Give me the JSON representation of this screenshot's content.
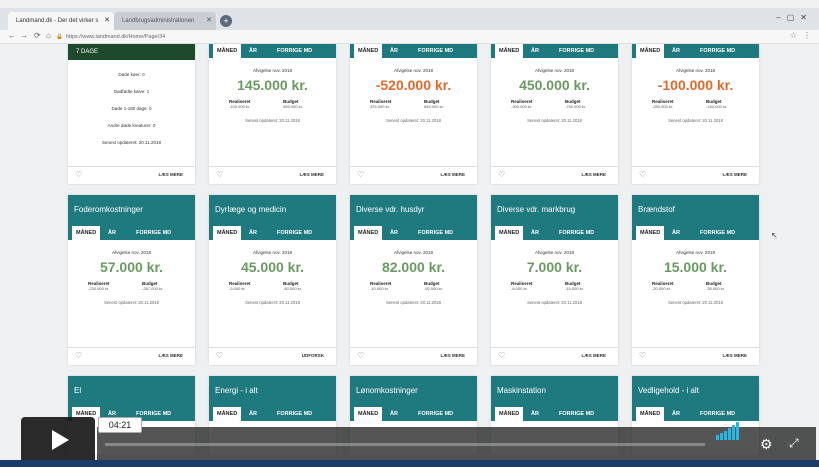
{
  "browser": {
    "tab_active": "Landmand.dk - Der det virker s",
    "tab_inactive": "Landbrugsadministrationen",
    "url": "https://www.landmand.dk/Home/Page/34",
    "new_tab": "+"
  },
  "first_card": {
    "header": "7 DAGE",
    "stats": [
      "Døde køer: 0",
      "Dødfødte kalve: 1",
      "Døde 1-180 dage: 0",
      "Andre døde kreaturer: 0"
    ],
    "updated": "Senest opdateret: 20.11.2018",
    "more": "LÆS MERE"
  },
  "tabs": {
    "t1": "MÅNED",
    "t2": "ÅR",
    "t3": "FORRIGE MD"
  },
  "row1": [
    {
      "amount": "145.000 kr.",
      "negative": false,
      "real": "-100.000 kr.",
      "budget": "355.000 kr."
    },
    {
      "amount": "-520.000 kr.",
      "negative": true,
      "real": "325.000 kr.",
      "budget": "845.000 kr."
    },
    {
      "amount": "450.000 kr.",
      "negative": false,
      "real": "-300.000 kr.",
      "budget": "-750.000 kr."
    },
    {
      "amount": "-100.000 kr.",
      "negative": true,
      "real": "-250.000 kr.",
      "budget": "-150.000 kr."
    }
  ],
  "row2": [
    {
      "title": "Foderomkostninger",
      "amount": "57.000 kr.",
      "real": "-230.000 kr.",
      "budget": "-287.000 kr.",
      "more": "LÆS MERE"
    },
    {
      "title": "Dyrlæge og medicin",
      "amount": "45.000 kr.",
      "real": "-5.000 kr.",
      "budget": "-50.000 kr.",
      "more": "UDFORSK"
    },
    {
      "title": "Diverse vdr. husdyr",
      "amount": "82.000 kr.",
      "real": "-10.000 kr.",
      "budget": "-92.000 kr.",
      "more": "LÆS MERE"
    },
    {
      "title": "Diverse vdr. markbrug",
      "amount": "7.000 kr.",
      "real": "-8.000 kr.",
      "budget": "-15.000 kr.",
      "more": "LÆS MERE"
    },
    {
      "title": "Brændstof",
      "amount": "15.000 kr.",
      "real": "-20.000 kr.",
      "budget": "-35.000 kr.",
      "more": "LÆS MERE"
    }
  ],
  "row3": [
    {
      "title": "El"
    },
    {
      "title": "Energi - i alt"
    },
    {
      "title": "Lønomkostninger"
    },
    {
      "title": "Maskinstation"
    },
    {
      "title": "Vedligehold - i alt"
    }
  ],
  "labels": {
    "deviation": "Afvigelse nov. 2018",
    "real": "Realiseret",
    "budget": "Budget",
    "updated": "Senest opdateret: 20.11.2018",
    "more": "LÆS MERE"
  },
  "video": {
    "time": "04:21"
  }
}
